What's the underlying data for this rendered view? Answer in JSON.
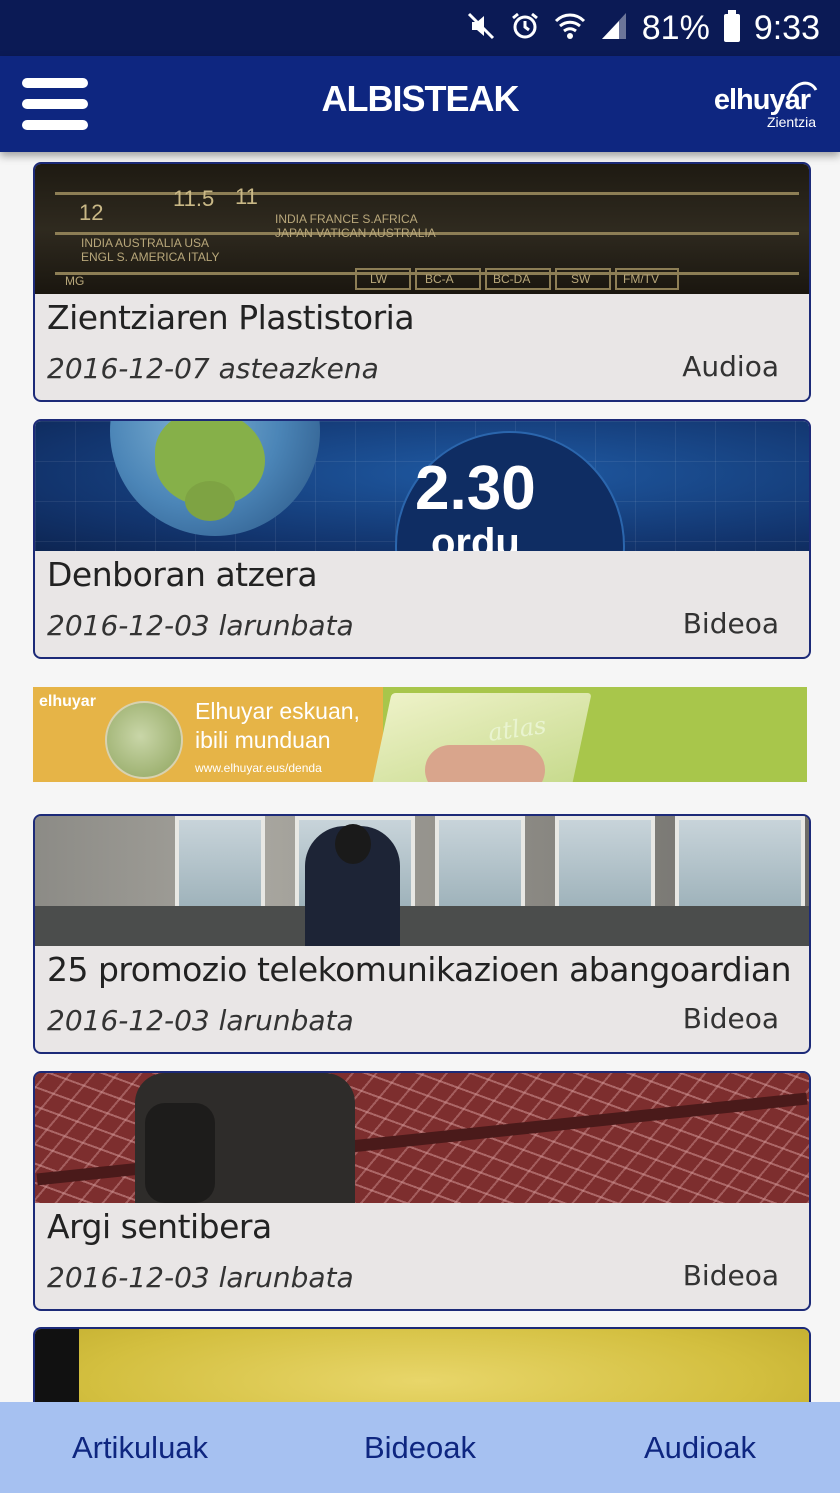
{
  "status_bar": {
    "battery": "81%",
    "time": "9:33",
    "icons": [
      "mute-icon",
      "alarm-icon",
      "wifi-icon",
      "signal-icon",
      "battery-icon"
    ]
  },
  "app_bar": {
    "title": "ALBISTEAK",
    "logo_word": "elhuyar",
    "logo_sub": "Zientzia",
    "menu_icon": "hamburger-menu-icon"
  },
  "colors": {
    "status_bar": "#0b1a55",
    "app_bar": "#0e2680",
    "card_border": "#1c2a78",
    "card_bg": "#e9e6e6",
    "bottom_nav": "#a6c1f1"
  },
  "feed": {
    "items": [
      {
        "title": "Zientziaren Plastistoria",
        "date": "2016-12-07 asteazkena",
        "type": "Audioa"
      },
      {
        "title": "Denboran atzera",
        "date": "2016-12-03 larunbata",
        "type": "Bideoa"
      },
      {
        "title": "25 promozio telekomunikazioen abangoardian",
        "date": "2016-12-03 larunbata",
        "type": "Bideoa"
      },
      {
        "title": "Argi sentibera",
        "date": "2016-12-03 larunbata",
        "type": "Bideoa"
      }
    ],
    "thumb_texts": {
      "radio_numbers": [
        "12",
        "11.5",
        "11"
      ],
      "radio_labels": [
        "INDIA  AUSTRALIA  USA",
        "ENGL  S. AMERICA  ITALY",
        "INDIA  FRANCE  S.AFRICA",
        "JAPAN  VATICAN  AUSTRALIA",
        "LW",
        "BC-A",
        "BC-DA",
        "SW",
        "FM/TV",
        "MG"
      ],
      "earth_number": "2.30",
      "earth_unit": "ordu"
    }
  },
  "ad": {
    "brand": "elhuyar",
    "slogan_line1": "Elhuyar eskuan,",
    "slogan_line2": "ibili munduan",
    "url": "www.elhuyar.eus/denda",
    "book_title": "atlas"
  },
  "bottom_nav": {
    "tabs": [
      "Artikuluak",
      "Bideoak",
      "Audioak"
    ]
  }
}
